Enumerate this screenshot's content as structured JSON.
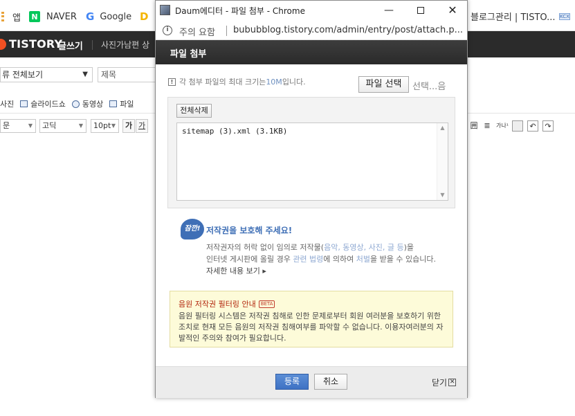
{
  "bookmarks": {
    "apps_label": "앱",
    "naver_label": "NAVER",
    "google_label": "Google",
    "blog_admin_label": "블로그관리 | TISTO..."
  },
  "tistory": {
    "logo": "TISTORY",
    "write": "글쓰기",
    "category_preview": "사진가남편 상"
  },
  "editor": {
    "category_select": "류 전체보기",
    "title_placeholder": "제목",
    "attach_items": [
      "사진",
      "슬라이드쇼",
      "동영상",
      "파일"
    ],
    "font_select": "문",
    "font_family": "고딕",
    "font_size": "10pt",
    "bold_btn": "가",
    "underline_btn": "가"
  },
  "popup": {
    "window_title": "Daum에디터 - 파일 첨부 - Chrome",
    "url_warning": "주의 요함",
    "url": "bububblog.tistory.com/admin/entry/post/attach.p...",
    "header_title": "파일 첨부",
    "limit_text_prefix": "각 첨부 파일의 최대 크기는 ",
    "limit_size": "10M",
    "limit_text_suffix": " 입니다.",
    "file_select_label": "파일 선택",
    "file_select_status": "선택...음",
    "delete_all_label": "전체삭제",
    "files": [
      "sitemap (3).xml (3.1KB)"
    ],
    "copyright": {
      "badge": "잠깐!",
      "title": "저작권을 보호해 주세요!",
      "line1_a": "저작권자의 허락 없이 임의로 저작물(",
      "line1_hl": "음악, 동영상, 사진, 글 등",
      "line1_b": ")을",
      "line2_a": "인터넷 게시판에 올릴 경우 ",
      "line2_hl1": "관련 법령",
      "line2_b": "에 의하여 ",
      "line2_hl2": "처벌",
      "line2_c": "을 받을 수 있습니다.",
      "more": "자세한 내용 보기 ▸"
    },
    "music_filter": {
      "title": "음원 저작권 필터링 안내",
      "beta": "BETA",
      "text": "음원 필터링 시스템은 저작권 침해로 인한 문제로부터 회원 여러분을 보호하기 위한 조치로 현재 모든 음원의 저작권 침해여부를 파악할 수 없습니다. 이용자여러분의 자발적인 주의와 참여가 필요합니다."
    },
    "register_label": "등록",
    "cancel_label": "취소",
    "close_label": "닫기"
  }
}
